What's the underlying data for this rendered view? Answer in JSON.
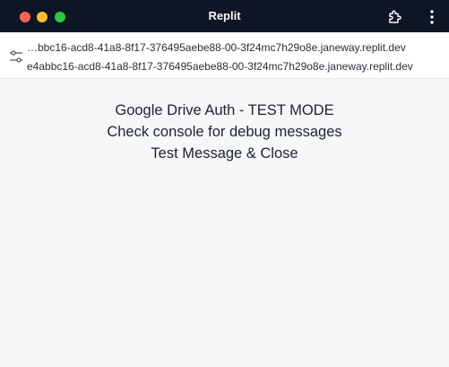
{
  "window": {
    "title": "Replit"
  },
  "toolbar": {
    "icons": [
      "extension-icon",
      "more-vertical-icon"
    ]
  },
  "urlbar": {
    "line1": "…bbc16-acd8-41a8-8f17-376495aebe88-00-3f24mc7h29o8e.janeway.replit.dev",
    "line2": "e4abbc16-acd8-41a8-8f17-376495aebe88-00-3f24mc7h29o8e.janeway.replit.dev",
    "icon": "sliders-icon"
  },
  "content": {
    "line1": "Google Drive Auth - TEST MODE",
    "line2": "Check console for debug messages",
    "line3": "Test Message & Close"
  }
}
